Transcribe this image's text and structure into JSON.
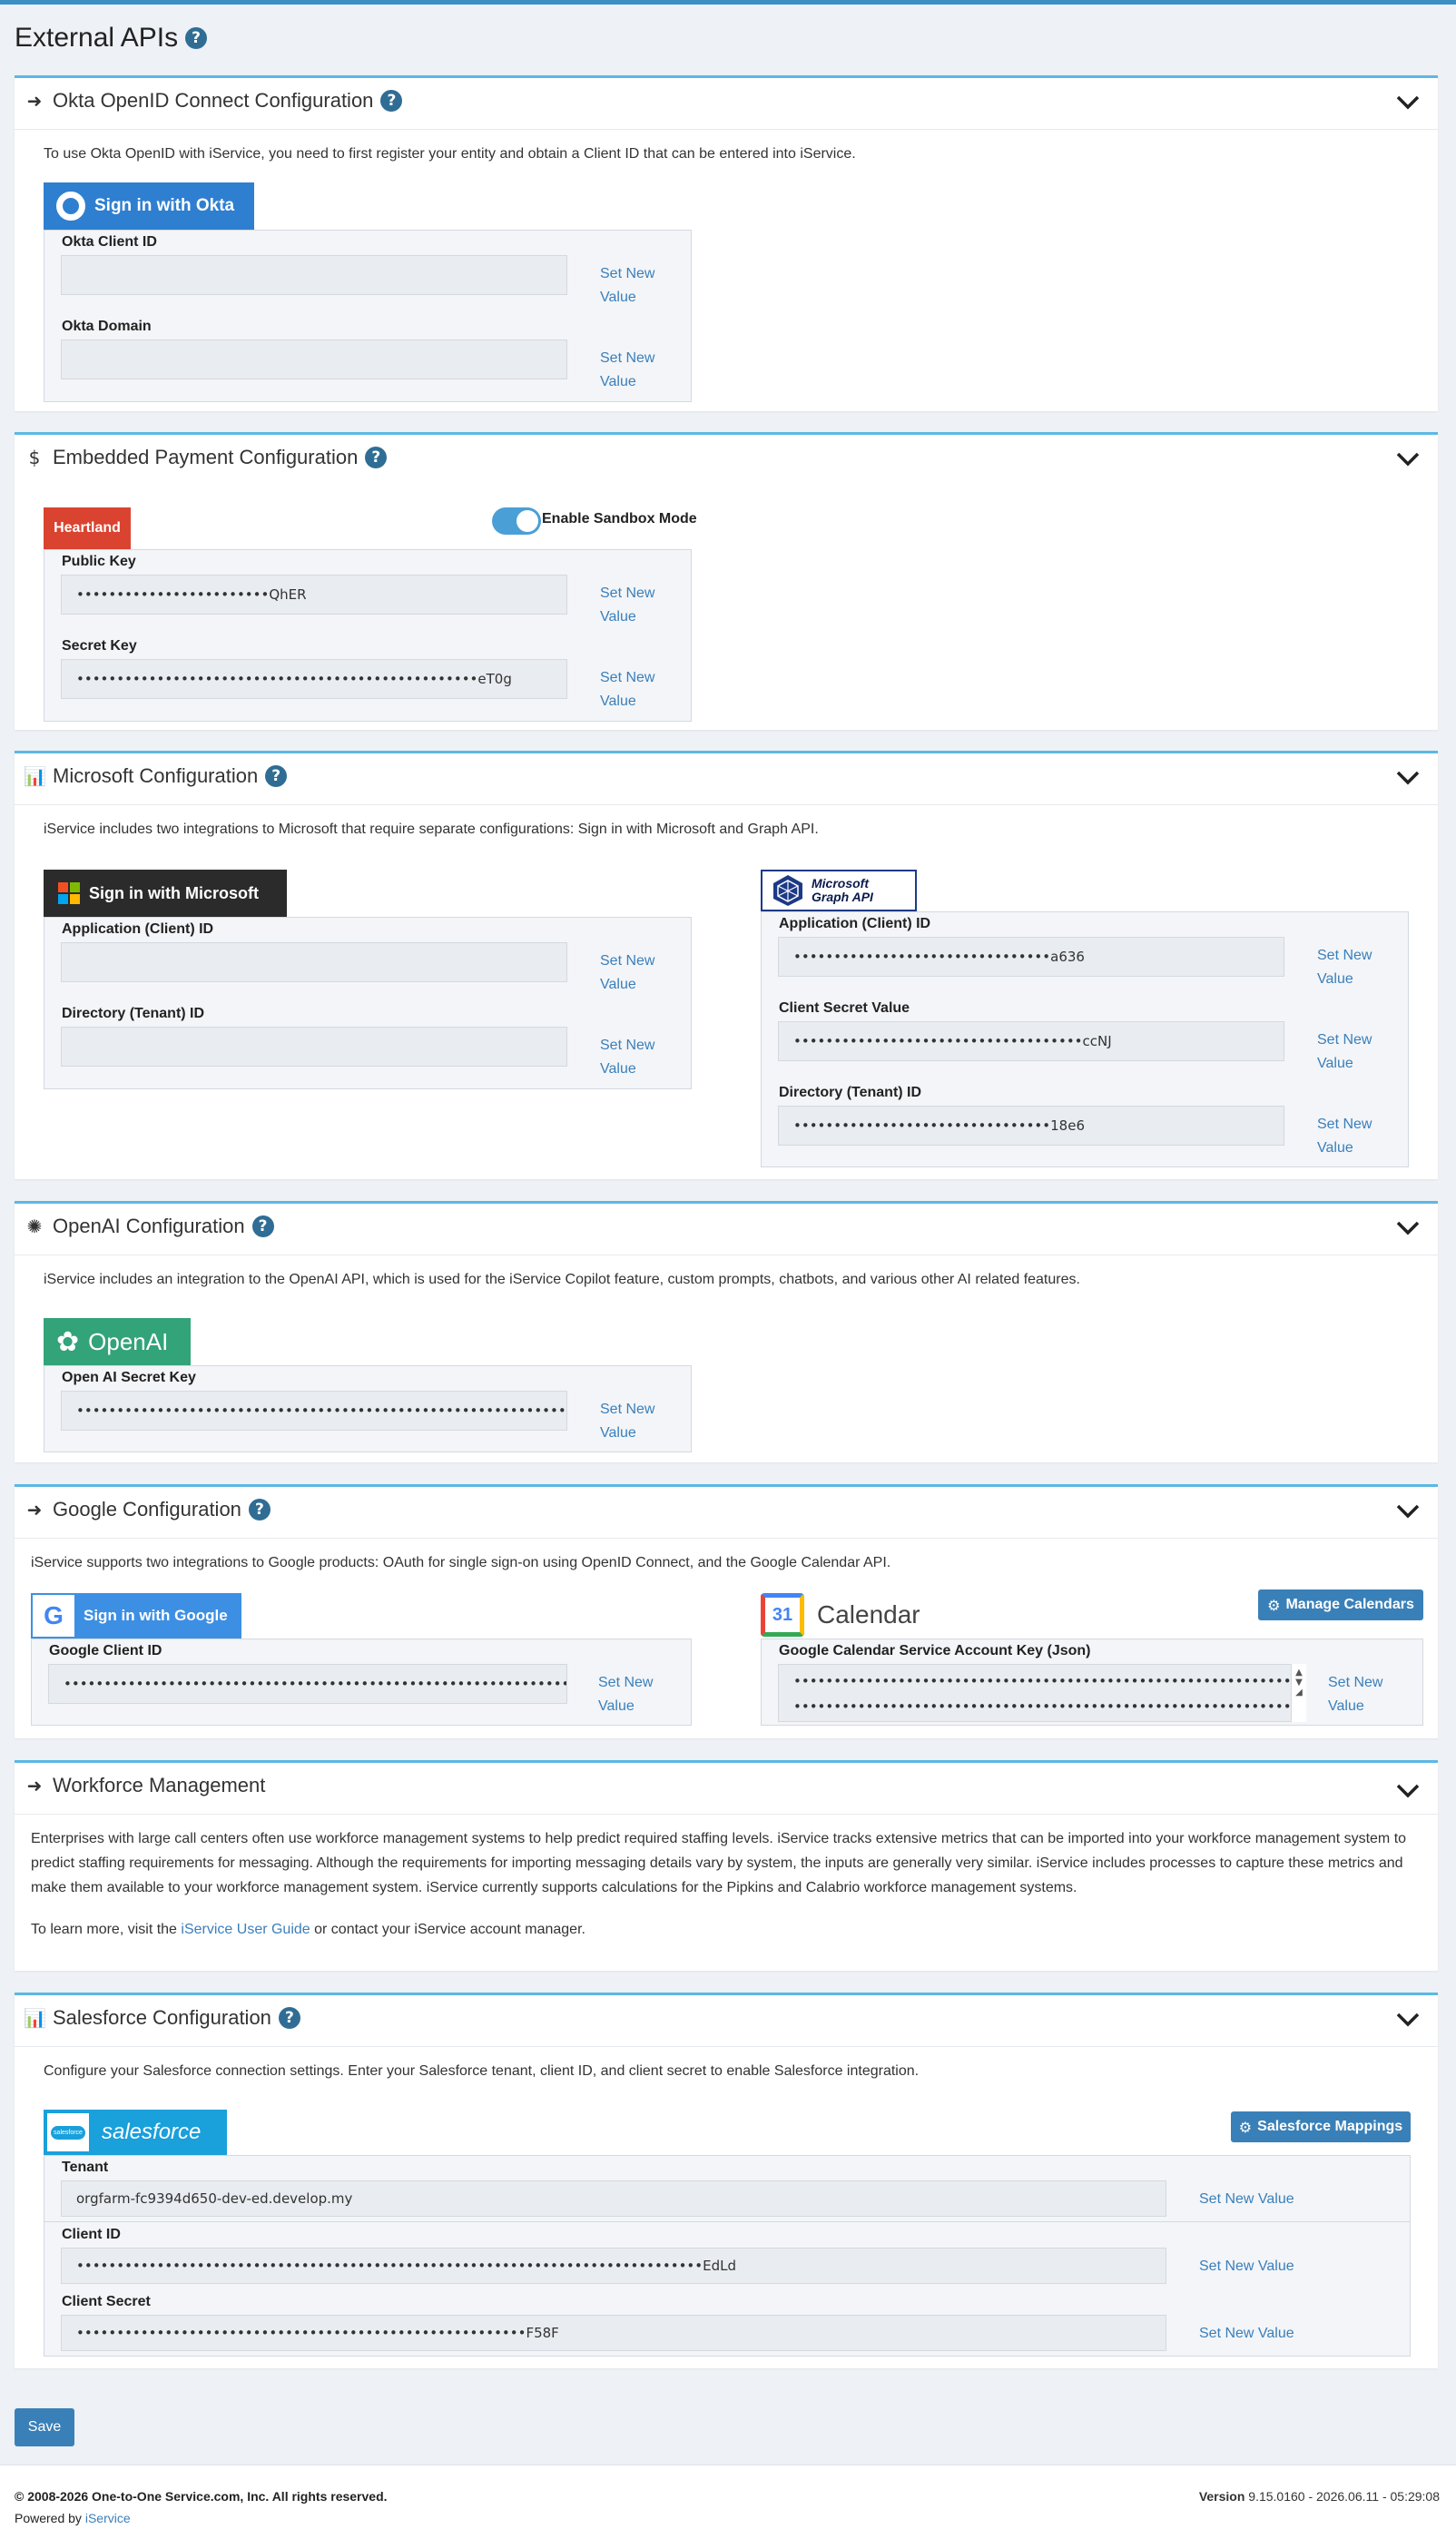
{
  "page": {
    "title": "External APIs"
  },
  "okta": {
    "title": "Okta OpenID Connect Configuration",
    "description": "To use Okta OpenID with iService, you need to first register your entity and obtain a Client ID that can be entered into iService.",
    "badge": "Sign in with Okta",
    "client_id_label": "Okta Client ID",
    "client_id_value": "",
    "domain_label": "Okta Domain",
    "domain_value": "",
    "set_new_1": "Set New",
    "set_new_2": "Value"
  },
  "payment": {
    "title": "Embedded Payment Configuration",
    "badge": "Heartland",
    "sandbox_label": "Enable Sandbox Mode",
    "public_key_label": "Public Key",
    "public_key_value": "••••••••••••••••••••••••QhER",
    "secret_key_label": "Secret Key",
    "secret_key_value": "••••••••••••••••••••••••••••••••••••••••••••••••••eT0g"
  },
  "microsoft": {
    "title": "Microsoft Configuration",
    "description": "iService includes two integrations to Microsoft that require separate configurations: Sign in with Microsoft and Graph API.",
    "signin_badge": "Sign in with Microsoft",
    "graph_badge_1": "Microsoft",
    "graph_badge_2": "Graph API",
    "app_id_label": "Application (Client) ID",
    "app_id_value": "",
    "dir_id_label": "Directory (Tenant) ID",
    "dir_id_value": "",
    "graph_app_id_label": "Application (Client) ID",
    "graph_app_id_value": "••••••••••••••••••••••••••••••••a636",
    "graph_secret_label": "Client Secret Value",
    "graph_secret_value": "••••••••••••••••••••••••••••••••••••ccNJ",
    "graph_dir_label": "Directory (Tenant) ID",
    "graph_dir_value": "••••••••••••••••••••••••••••••••18e6"
  },
  "openai": {
    "title": "OpenAI Configuration",
    "description": "iService includes an integration to the OpenAI API, which is used for the iService Copilot feature, custom prompts, chatbots, and various other AI related features.",
    "badge": "OpenAI",
    "key_label": "Open AI Secret Key",
    "key_value": "••••••••••••••••••••••••••••••••••••••••••••••••••••••••••••••••••••••••••••••••"
  },
  "google": {
    "title": "Google Configuration",
    "description": "iService supports two integrations to Google products: OAuth for single sign-on using OpenID Connect, and the Google Calendar API.",
    "signin_badge": "Sign in with Google",
    "calendar_badge": "Calendar",
    "calendar_day": "31",
    "manage_calendars": "Manage Calendars",
    "client_id_label": "Google Client ID",
    "client_id_value": "••••••••••••••••••••••••••••••••••••••••••••••••••••••••••••••••••••••••.com",
    "service_key_label": "Google Calendar Service Account Key (Json)",
    "service_key_line": "•••••••••••••••••••••••••••••••••••••••••••••••••••••••••••••••••••••••••••"
  },
  "workforce": {
    "title": "Workforce Management",
    "paragraph": "Enterprises with large call centers often use workforce management systems to help predict required staffing levels. iService tracks extensive metrics that can be imported into your workforce management system to predict staffing requirements for messaging. Although the requirements for importing messaging details vary by system, the inputs are generally very similar. iService includes processes to capture these metrics and make them available to your workforce management system. iService currently supports calculations for the Pipkins and Calabrio workforce management systems.",
    "learn_pre": "To learn more, visit the ",
    "learn_link": "iService User Guide",
    "learn_post": " or contact your iService account manager."
  },
  "salesforce": {
    "title": "Salesforce Configuration",
    "description": "Configure your Salesforce connection settings. Enter your Salesforce tenant, client ID, and client secret to enable Salesforce integration.",
    "badge": "salesforce",
    "logo_text": "salesforce",
    "mappings_button": "Salesforce Mappings",
    "tenant_label": "Tenant",
    "tenant_value": "orgfarm-fc9394d650-dev-ed.develop.my",
    "client_id_label": "Client ID",
    "client_id_value": "••••••••••••••••••••••••••••••••••••••••••••••••••••••••••••••••••••••••••••••EdLd",
    "client_secret_label": "Client Secret",
    "client_secret_value": "••••••••••••••••••••••••••••••••••••••••••••••••••••••••F58F",
    "set_new_value": "Set New Value"
  },
  "actions": {
    "save": "Save"
  },
  "footer": {
    "copyright": "© 2008-2026 One-to-One Service.com, Inc. All rights reserved.",
    "powered_by": "Powered by ",
    "powered_link": "iService",
    "version_label": "Version",
    "version_value": " 9.15.0160 - 2026.06.11 - 05:29:08"
  },
  "colors": {
    "accent": "#5bb8e4",
    "okta": "#2f7fd0",
    "heartland": "#d9432f",
    "microsoft_badge": "#2b2b2b",
    "openai": "#33a37a",
    "google_badge": "#3d8fe3",
    "salesforce": "#1aa0db",
    "button": "#3a80b8"
  }
}
